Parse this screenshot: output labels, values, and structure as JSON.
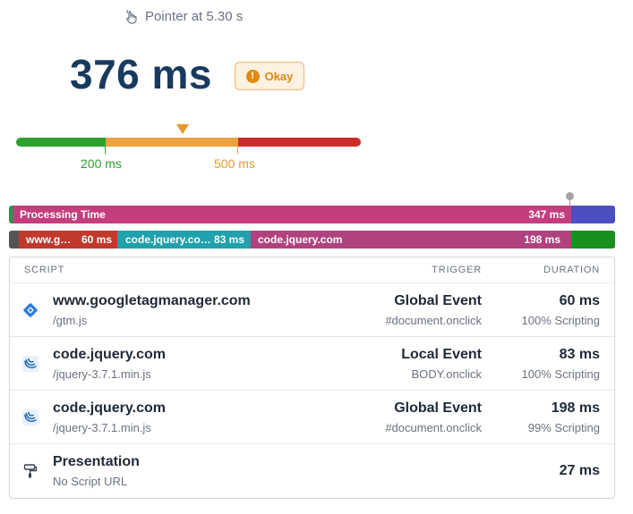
{
  "header": {
    "pointer_icon": "pointer-hand-icon",
    "pointer_label": "Pointer at 5.30 s",
    "value": "376 ms",
    "badge_icon": "exclamation-icon",
    "badge_label": "Okay"
  },
  "thresholds": {
    "good": "200 ms",
    "poor": "500 ms",
    "marker_value_ms": 376,
    "colors": {
      "good": "#2ea02e",
      "ni": "#eea23f",
      "poor": "#cc2b2b"
    }
  },
  "processing_bar": {
    "label": "Processing Time",
    "value": "347 ms",
    "colors": {
      "main": "#c43d7d",
      "end": "#4c4fc2",
      "start": "#14a04a"
    }
  },
  "scripts_bar": {
    "segments": [
      {
        "label": "www.g…",
        "value": "60 ms",
        "color": "#c0392b"
      },
      {
        "label": "code.jquery.co…",
        "value": "83 ms",
        "color": "#21a0ad"
      },
      {
        "label": "code.jquery.com",
        "value": "198 ms",
        "color": "#b0427e"
      }
    ],
    "colors": {
      "start": "#555555",
      "end": "#17901d"
    }
  },
  "table": {
    "headers": {
      "script": "SCRIPT",
      "trigger": "TRIGGER",
      "duration": "DURATION"
    },
    "rows": [
      {
        "icon": "google-tag-manager-icon",
        "name": "www.googletagmanager.com",
        "sub": "/gtm.js",
        "trigger": "Global Event",
        "trigger_sub": "#document.onclick",
        "duration": "60 ms",
        "duration_sub": "100% Scripting"
      },
      {
        "icon": "jquery-icon",
        "name": "code.jquery.com",
        "sub": "/jquery-3.7.1.min.js",
        "trigger": "Local Event",
        "trigger_sub": "BODY.onclick",
        "duration": "83 ms",
        "duration_sub": "100% Scripting"
      },
      {
        "icon": "jquery-icon",
        "name": "code.jquery.com",
        "sub": "/jquery-3.7.1.min.js",
        "trigger": "Global Event",
        "trigger_sub": "#document.onclick",
        "duration": "198 ms",
        "duration_sub": "99% Scripting"
      },
      {
        "icon": "paint-roller-icon",
        "name": "Presentation",
        "sub": "No Script URL",
        "trigger": "",
        "trigger_sub": "",
        "duration": "27 ms",
        "duration_sub": ""
      }
    ]
  }
}
